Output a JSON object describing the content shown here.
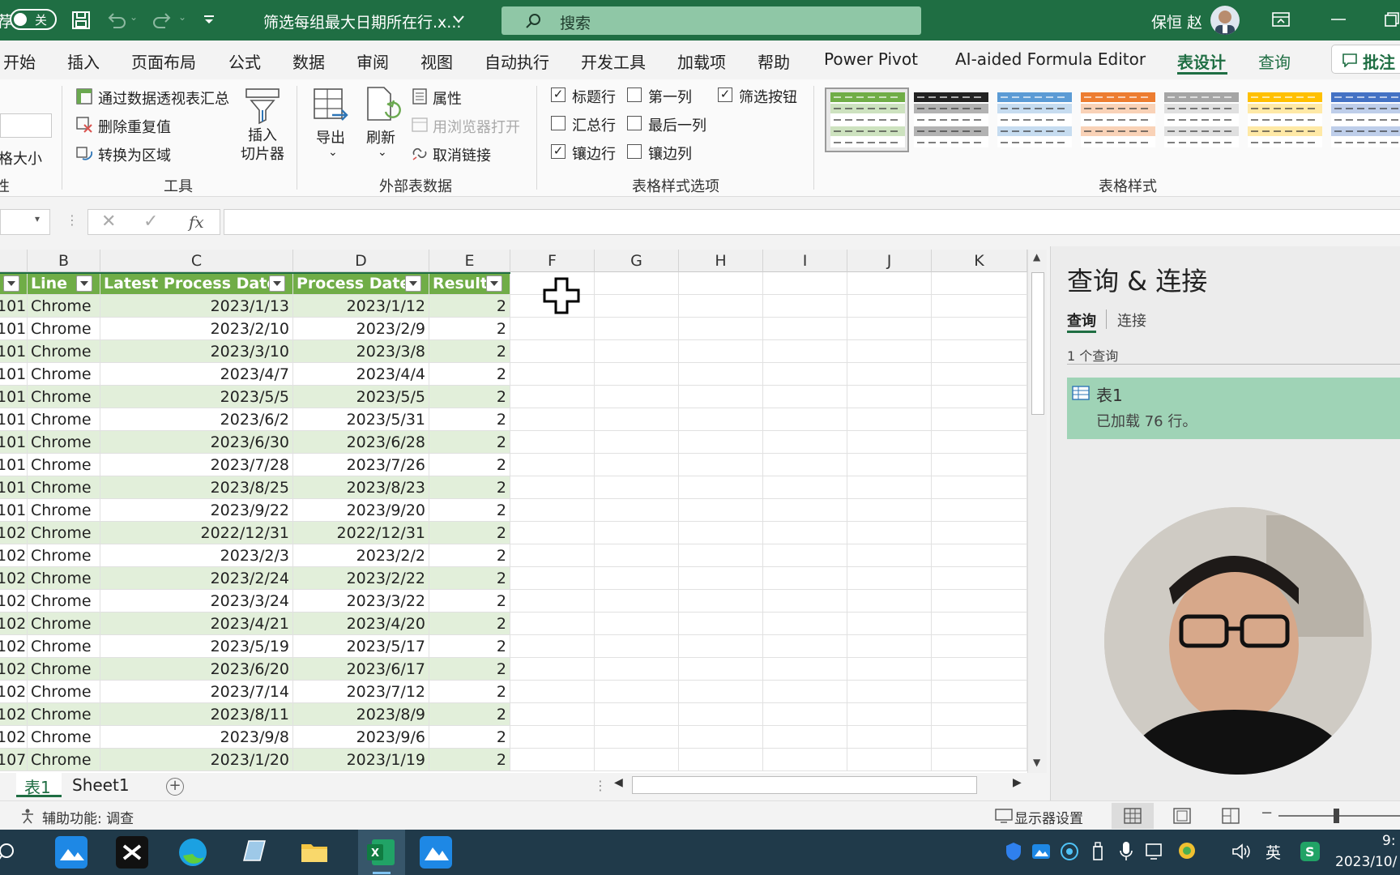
{
  "titlebar": {
    "autosave_label": "关",
    "file_title": "筛选每组最大日期所在行.x...",
    "search_placeholder": "搜索",
    "user_name": "保恒 赵"
  },
  "menu": {
    "tabs": [
      "开始",
      "插入",
      "页面布局",
      "公式",
      "数据",
      "审阅",
      "视图",
      "自动执行",
      "开发工具",
      "加载项",
      "帮助",
      "Power Pivot",
      "AI-aided Formula Editor",
      "表设计",
      "查询"
    ],
    "active_tab": "表设计",
    "comment_button": "批注"
  },
  "ribbon": {
    "props_partial_label": "格大小",
    "props_partial_group": "性",
    "tools": {
      "summarize_pivot": "通过数据透视表汇总",
      "remove_duplicates": "删除重复值",
      "convert_range": "转换为区域",
      "insert_slicer": "插入\n切片器",
      "group_label": "工具"
    },
    "external": {
      "export": "导出",
      "refresh": "刷新",
      "properties": "属性",
      "open_browser": "用浏览器打开",
      "unlink": "取消链接",
      "group_label": "外部表数据"
    },
    "style_options": {
      "header_row": "标题行",
      "first_column": "第一列",
      "filter_button": "筛选按钮",
      "total_row": "汇总行",
      "last_column": "最后一列",
      "banded_rows": "镶边行",
      "banded_columns": "镶边列",
      "group_label": "表格样式选项"
    },
    "styles_group_label": "表格样式",
    "style_colors": [
      "#70ad47",
      "#222222",
      "#5b9bd5",
      "#ed7d31",
      "#a5a5a5",
      "#ffc000",
      "#4472c4"
    ]
  },
  "formula_bar": {
    "fx_label": "fx",
    "formula": ""
  },
  "grid": {
    "column_letters": [
      "",
      "B",
      "C",
      "D",
      "E",
      "F",
      "G",
      "H",
      "I",
      "J",
      "K"
    ],
    "table_headers": [
      "",
      "Line",
      "Latest Process Date",
      "Process Date",
      "Result"
    ],
    "rows": [
      [
        "101",
        "Chrome",
        "2023/1/13",
        "2023/1/12",
        "2"
      ],
      [
        "101",
        "Chrome",
        "2023/2/10",
        "2023/2/9",
        "2"
      ],
      [
        "101",
        "Chrome",
        "2023/3/10",
        "2023/3/8",
        "2"
      ],
      [
        "101",
        "Chrome",
        "2023/4/7",
        "2023/4/4",
        "2"
      ],
      [
        "101",
        "Chrome",
        "2023/5/5",
        "2023/5/5",
        "2"
      ],
      [
        "101",
        "Chrome",
        "2023/6/2",
        "2023/5/31",
        "2"
      ],
      [
        "101",
        "Chrome",
        "2023/6/30",
        "2023/6/28",
        "2"
      ],
      [
        "101",
        "Chrome",
        "2023/7/28",
        "2023/7/26",
        "2"
      ],
      [
        "101",
        "Chrome",
        "2023/8/25",
        "2023/8/23",
        "2"
      ],
      [
        "101",
        "Chrome",
        "2023/9/22",
        "2023/9/20",
        "2"
      ],
      [
        "102",
        "Chrome",
        "2022/12/31",
        "2022/12/31",
        "2"
      ],
      [
        "102",
        "Chrome",
        "2023/2/3",
        "2023/2/2",
        "2"
      ],
      [
        "102",
        "Chrome",
        "2023/2/24",
        "2023/2/22",
        "2"
      ],
      [
        "102",
        "Chrome",
        "2023/3/24",
        "2023/3/22",
        "2"
      ],
      [
        "102",
        "Chrome",
        "2023/4/21",
        "2023/4/20",
        "2"
      ],
      [
        "102",
        "Chrome",
        "2023/5/19",
        "2023/5/17",
        "2"
      ],
      [
        "102",
        "Chrome",
        "2023/6/20",
        "2023/6/17",
        "2"
      ],
      [
        "102",
        "Chrome",
        "2023/7/14",
        "2023/7/12",
        "2"
      ],
      [
        "102",
        "Chrome",
        "2023/8/11",
        "2023/8/9",
        "2"
      ],
      [
        "102",
        "Chrome",
        "2023/9/8",
        "2023/9/6",
        "2"
      ],
      [
        "107",
        "Chrome",
        "2023/1/20",
        "2023/1/19",
        "2"
      ]
    ]
  },
  "sheets": {
    "tabs": [
      "表1",
      "Sheet1"
    ],
    "active": "表1"
  },
  "pane": {
    "title": "查询 & 连接",
    "tab_queries": "查询",
    "tab_connections": "连接",
    "query_count": "1 个查询",
    "query_name": "表1",
    "query_status": "已加载 76 行。"
  },
  "status": {
    "accessibility": "辅助功能: 调查",
    "display_settings": "显示器设置"
  },
  "taskbar": {
    "ime": "英",
    "time": "9:",
    "date": "2023/10/"
  }
}
